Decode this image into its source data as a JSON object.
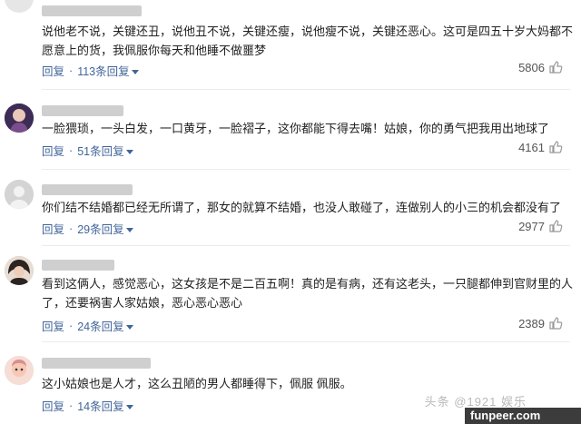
{
  "comments": [
    {
      "text": "说他老不说，关键还丑，说他丑不说，关键还瘦，说他瘦不说，关键还恶心。这可是四五十岁大妈都不愿意上的货，我佩服你每天和他睡不做噩梦",
      "reply_label": "回复",
      "replies_label": "113条回复",
      "likes": "5806"
    },
    {
      "text": "一脸猥琐，一头白发，一口黄牙，一脸褶子，这你都能下得去嘴！姑娘，你的勇气把我用出地球了",
      "reply_label": "回复",
      "replies_label": "51条回复",
      "likes": "4161"
    },
    {
      "text": "你们结不结婚都已经无所谓了，那女的就算不结婚，也没人敢碰了，连做别人的小三的机会都没有了",
      "reply_label": "回复",
      "replies_label": "29条回复",
      "likes": "2977"
    },
    {
      "text": "看到这俩人，感觉恶心，这女孩是不是二百五啊！真的是有病，还有这老头，一只腿都伸到官财里的人了，还要祸害人家姑娘，恶心恶心恶心",
      "reply_label": "回复",
      "replies_label": "24条回复",
      "likes": "2389"
    },
    {
      "text": "这小姑娘也是人才，这么丑陋的男人都睡得下，佩服 佩服。",
      "reply_label": "回复",
      "replies_label": "14条回复",
      "likes": ""
    }
  ],
  "watermark": {
    "text": "头条 @1921 娱乐",
    "brand": "funpeer.com"
  },
  "colors": {
    "link": "#406599",
    "text": "#222222",
    "likes": "#555555"
  }
}
